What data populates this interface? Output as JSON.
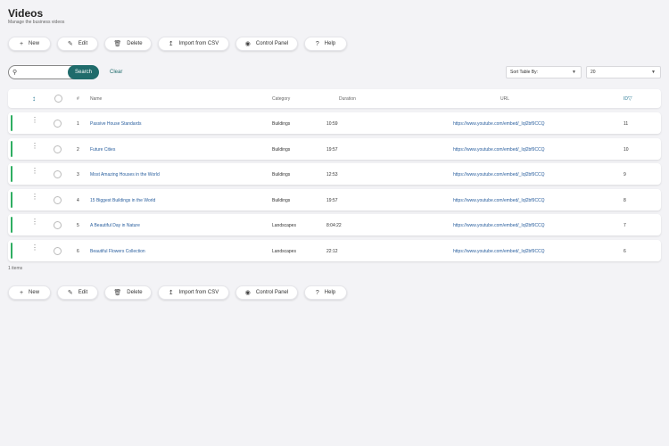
{
  "page": {
    "title": "Videos",
    "subtitle": "Manage the business videos"
  },
  "toolbar": {
    "new_label": "New",
    "edit_label": "Edit",
    "delete_label": "Delete",
    "import_label": "Import from CSV",
    "control_panel_label": "Control Panel",
    "help_label": "Help"
  },
  "search": {
    "value": "",
    "button_label": "Search",
    "clear_label": "Clear"
  },
  "sort": {
    "placeholder": "Sort Table By:"
  },
  "page_size": {
    "selected": "20"
  },
  "table": {
    "headers": {
      "num": "#",
      "name": "Name",
      "category": "Category",
      "duration": "Duration",
      "url": "URL",
      "id": "ID"
    },
    "rows": [
      {
        "num": "1",
        "name": "Passive House Standards",
        "category": "Buildings",
        "duration": "10:59",
        "url": "https://www.youtube.com/embed/_Iql2bf9CCQ",
        "id": "11"
      },
      {
        "num": "2",
        "name": "Future Cities",
        "category": "Buildings",
        "duration": "19:57",
        "url": "https://www.youtube.com/embed/_Iql2bf9CCQ",
        "id": "10"
      },
      {
        "num": "3",
        "name": "Most Amazing Houses in the World",
        "category": "Buildings",
        "duration": "12:53",
        "url": "https://www.youtube.com/embed/_Iql2bf9CCQ",
        "id": "9"
      },
      {
        "num": "4",
        "name": "15 Biggest Buildings in the World",
        "category": "Buildings",
        "duration": "19:57",
        "url": "https://www.youtube.com/embed/_Iql2bf9CCQ",
        "id": "8"
      },
      {
        "num": "5",
        "name": "A Beautiful Day in Nature",
        "category": "Landscapes",
        "duration": "8:04:22",
        "url": "https://www.youtube.com/embed/_Iql2bf9CCQ",
        "id": "7"
      },
      {
        "num": "6",
        "name": "Beautiful Flowers Collection",
        "category": "Landscapes",
        "duration": "22:12",
        "url": "https://www.youtube.com/embed/_Iql2bf9CCQ",
        "id": "6"
      }
    ]
  },
  "footer": {
    "count_text": "1 items"
  },
  "colors": {
    "accent": "#1f6b6b",
    "row_indicator": "#2fae62",
    "link": "#2a5f9e"
  },
  "icons": {
    "new": "plus-icon",
    "edit": "edit-icon",
    "delete": "trash-icon",
    "import": "upload-icon",
    "control_panel": "gauge-icon",
    "help": "help-icon",
    "search": "search-icon",
    "sort": "sort-icon",
    "row_menu": "kebab-menu-icon"
  }
}
